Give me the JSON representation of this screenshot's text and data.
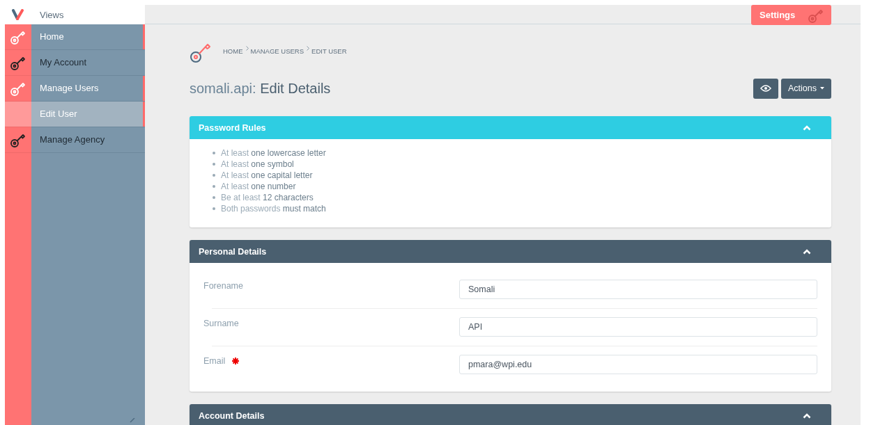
{
  "app": {
    "title": "Views"
  },
  "sidebar": {
    "items": [
      {
        "label": "Home",
        "active": true,
        "selected": false
      },
      {
        "label": "My Account",
        "active": false,
        "selected": false
      },
      {
        "label": "Manage Users",
        "active": true,
        "selected": false,
        "children": [
          {
            "label": "Edit User",
            "active": true,
            "selected": true
          }
        ]
      },
      {
        "label": "Manage Agency",
        "active": false,
        "selected": false
      }
    ]
  },
  "topbar": {
    "settings_tab": "Settings"
  },
  "breadcrumb": [
    "HOME",
    "MANAGE USERS",
    "EDIT USER"
  ],
  "page_title": {
    "user": "somali.api:",
    "rest": "Edit Details"
  },
  "actions": {
    "label": "Actions"
  },
  "panels": [
    {
      "kind": "info",
      "title": "Password Rules",
      "expanded": true,
      "rules": [
        "At least **one lowercase letter**",
        "At least **one symbol**",
        "At least **one capital letter**",
        "At least **one number**",
        "Be at least **12 characters**",
        "Both passwords **must match**"
      ]
    },
    {
      "kind": "form",
      "title": "Personal Details",
      "expanded": true,
      "fields": [
        {
          "label": "Forename",
          "value": "Somali",
          "required": false
        },
        {
          "label": "Surname",
          "value": "API",
          "required": false
        },
        {
          "label": "Email",
          "value": "pmara@wpi.edu",
          "required": true
        }
      ]
    },
    {
      "kind": "form",
      "title": "Account Details",
      "expanded": true
    }
  ]
}
